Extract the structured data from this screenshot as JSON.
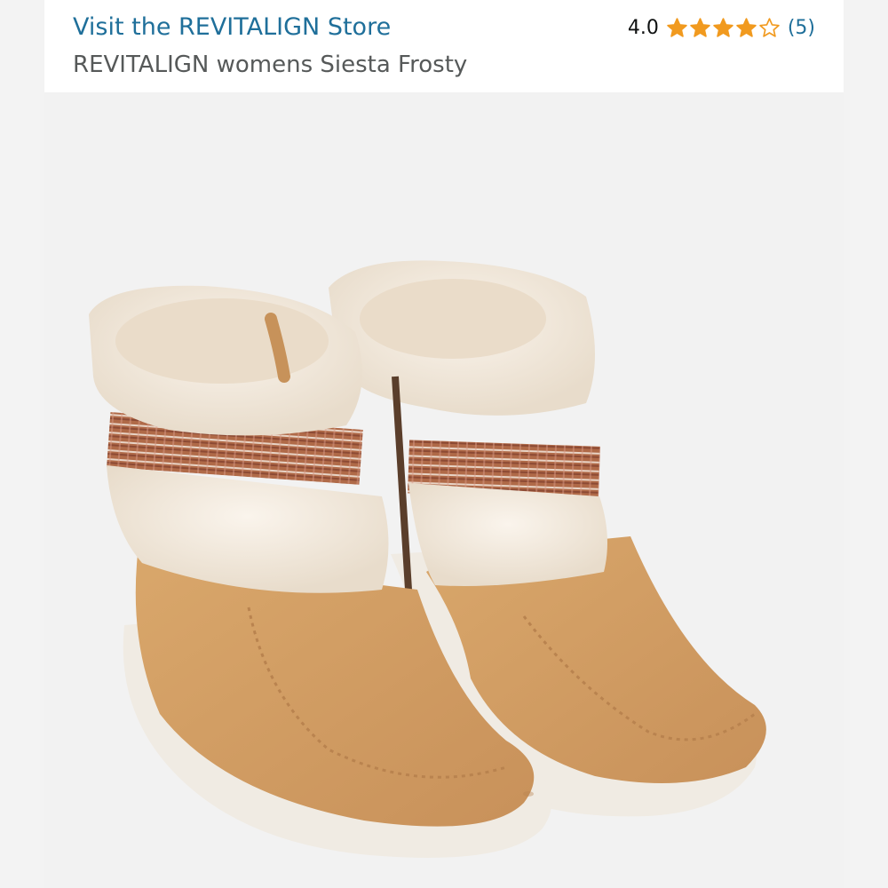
{
  "header": {
    "store_link": "Visit the REVITALIGN Store",
    "product_title": "REVITALIGN womens Siesta Frosty",
    "rating_value": "4.0",
    "rating_count": "(5)",
    "stars_filled": 4,
    "stars_total": 5
  },
  "product_image": {
    "subject": "pair of tan suede ankle boots with cream faux-fur cuffs",
    "icon": "product-photo"
  },
  "colors": {
    "link": "#1f6f9a",
    "star": "#f19a1f",
    "suede": "#d3a168",
    "fur": "#f3e9dc"
  }
}
